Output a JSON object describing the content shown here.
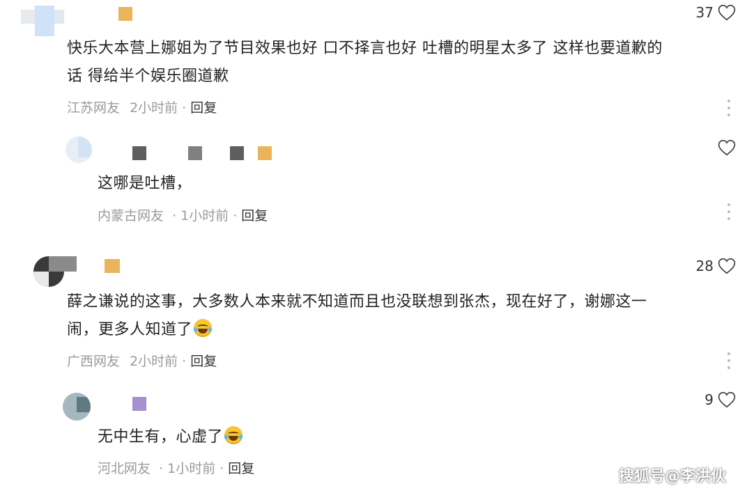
{
  "comments": [
    {
      "text_lines": [
        "快乐大本营上娜姐为了节目效果也好 口不择言也好 吐槽的明星太多了 这样也要道歉的",
        "话 得给半个娱乐圈道歉"
      ],
      "location": "江苏网友",
      "time": "2小时前",
      "reply_label": "回复",
      "likes": "37"
    },
    {
      "text_lines": [
        "这哪是吐槽，"
      ],
      "location": "内蒙古网友",
      "time": "1小时前",
      "reply_label": "回复",
      "likes": ""
    },
    {
      "text_lines": [
        "薛之谦说的这事，大多数人本来就不知道而且也没联想到张杰，现在好了，谢娜这一",
        "闹，更多人知道了"
      ],
      "location": "广西网友",
      "time": "2小时前",
      "reply_label": "回复",
      "likes": "28"
    },
    {
      "text_lines": [
        "无中生有，心虚了"
      ],
      "location": "河北网友",
      "time": "1小时前",
      "reply_label": "回复",
      "likes": "9"
    }
  ],
  "separator": "·",
  "watermark": "搜狐号@李洪伙",
  "icons": {
    "like": "heart-outline-icon",
    "more": "vertical-dots-icon",
    "emoji": "laughing-tears-emoji"
  },
  "colors": {
    "text": "#222222",
    "meta": "#9a9a9a",
    "icon": "#444444"
  }
}
